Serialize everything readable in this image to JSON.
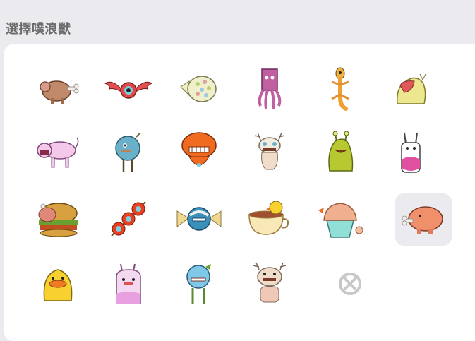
{
  "header": {
    "title": "選擇噗浪獸"
  },
  "picker": {
    "selected_index": 11,
    "items": [
      {
        "icon": "meat-pig-icon"
      },
      {
        "icon": "winged-eye-icon"
      },
      {
        "icon": "dotted-fish-icon"
      },
      {
        "icon": "pink-squid-icon"
      },
      {
        "icon": "gecko-icon"
      },
      {
        "icon": "yellow-bird-mask-icon"
      },
      {
        "icon": "pink-cat-icon"
      },
      {
        "icon": "blue-fluffy-bird-icon"
      },
      {
        "icon": "orange-robot-icon"
      },
      {
        "icon": "antler-creature-icon"
      },
      {
        "icon": "green-slug-icon"
      },
      {
        "icon": "white-bunny-icon"
      },
      {
        "icon": "turkey-burger-icon"
      },
      {
        "icon": "red-eye-skewer-icon"
      },
      {
        "icon": "candy-creature-icon"
      },
      {
        "icon": "teacup-duck-icon"
      },
      {
        "icon": "cupcake-icon"
      },
      {
        "icon": "pink-pig-icon"
      },
      {
        "icon": "yellow-duck-icon"
      },
      {
        "icon": "pink-ghost-bunny-icon"
      },
      {
        "icon": "blue-ball-icon"
      },
      {
        "icon": "antler-bear-icon"
      },
      {
        "icon": "no-selection-icon"
      }
    ]
  }
}
